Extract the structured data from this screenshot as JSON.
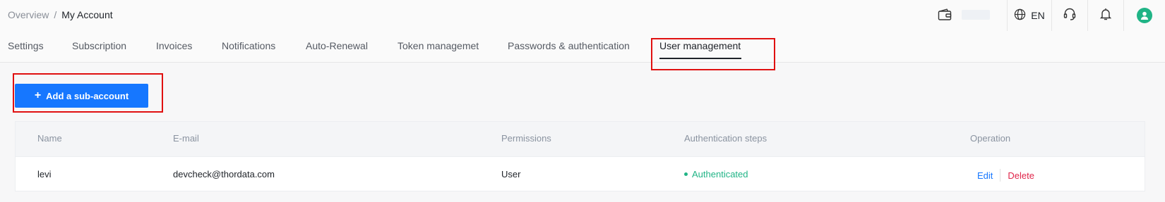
{
  "breadcrumb": {
    "parent": "Overview",
    "separator": "/",
    "current": "My Account"
  },
  "header": {
    "language": "EN"
  },
  "tabs": [
    {
      "label": "Settings"
    },
    {
      "label": "Subscription"
    },
    {
      "label": "Invoices"
    },
    {
      "label": "Notifications"
    },
    {
      "label": "Auto-Renewal"
    },
    {
      "label": "Token managemet"
    },
    {
      "label": "Passwords & authentication"
    },
    {
      "label": "User management"
    }
  ],
  "active_tab": "User management",
  "actions": {
    "add_sub_account": "Add a sub-account"
  },
  "table": {
    "columns": [
      "Name",
      "E-mail",
      "Permissions",
      "Authentication steps",
      "Operation"
    ],
    "rows": [
      {
        "name": "levi",
        "email": "devcheck@thordata.com",
        "permissions": "User",
        "authentication": "Authenticated",
        "edit": "Edit",
        "delete": "Delete"
      }
    ]
  },
  "colors": {
    "accent": "#1677ff",
    "success": "#20b486",
    "danger": "#e0254a",
    "highlight": "#e01010"
  },
  "icons": [
    "wallet-icon",
    "globe-icon",
    "headset-icon",
    "bell-icon",
    "user-avatar-icon",
    "plus-icon"
  ]
}
